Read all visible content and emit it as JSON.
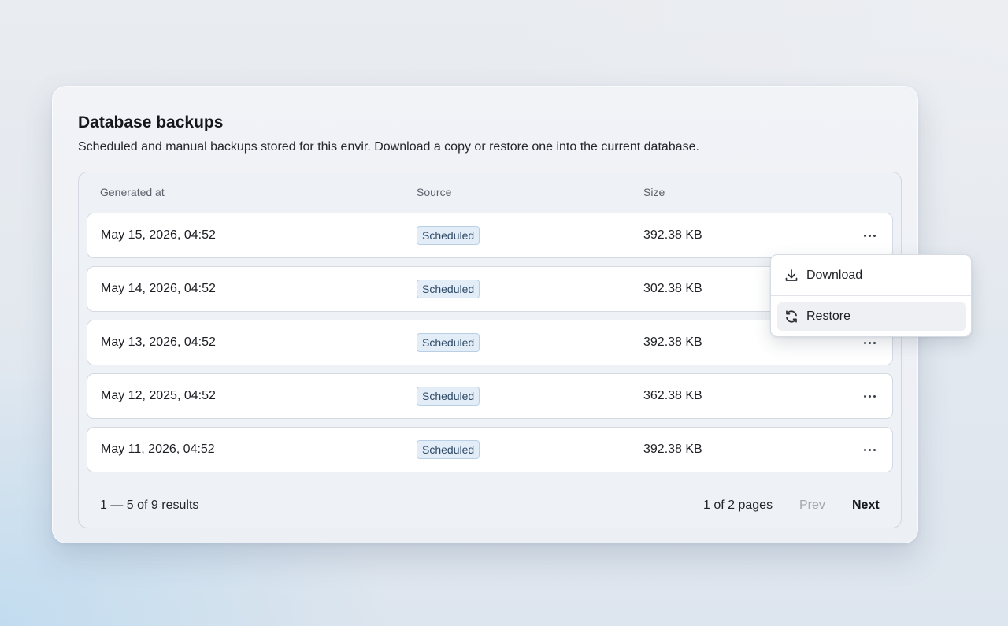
{
  "card": {
    "title": "Database backups",
    "description": "Scheduled and manual backups stored for this envir. Download a copy or restore one into the current database."
  },
  "table": {
    "columns": {
      "generated_at": "Generated at",
      "source": "Source",
      "size": "Size"
    },
    "rows": [
      {
        "generated_at": "May 15, 2026, 04:52",
        "source": "Scheduled",
        "size": "392.38 KB"
      },
      {
        "generated_at": "May 14, 2026, 04:52",
        "source": "Scheduled",
        "size": "302.38 KB"
      },
      {
        "generated_at": "May 13, 2026, 04:52",
        "source": "Scheduled",
        "size": "392.38 KB"
      },
      {
        "generated_at": "May 12, 2025, 04:52",
        "source": "Scheduled",
        "size": "362.38 KB"
      },
      {
        "generated_at": "May 11, 2026, 04:52",
        "source": "Scheduled",
        "size": "392.38 KB"
      }
    ],
    "row_action_icon": "more-horizontal-icon"
  },
  "pagination": {
    "results": "1 — 5 of 9 results",
    "pages": "1 of 2 pages",
    "prev_label": "Prev",
    "next_label": "Next"
  },
  "context_menu": {
    "items": [
      {
        "label": "Download",
        "icon": "download-icon"
      },
      {
        "label": "Restore",
        "icon": "refresh-icon",
        "highlighted": true
      }
    ]
  },
  "colors": {
    "badge_bg": "#e3edf8",
    "badge_border": "#b9cfe6",
    "badge_text": "#2f4a66",
    "disabled_text": "#a3a8b0"
  }
}
